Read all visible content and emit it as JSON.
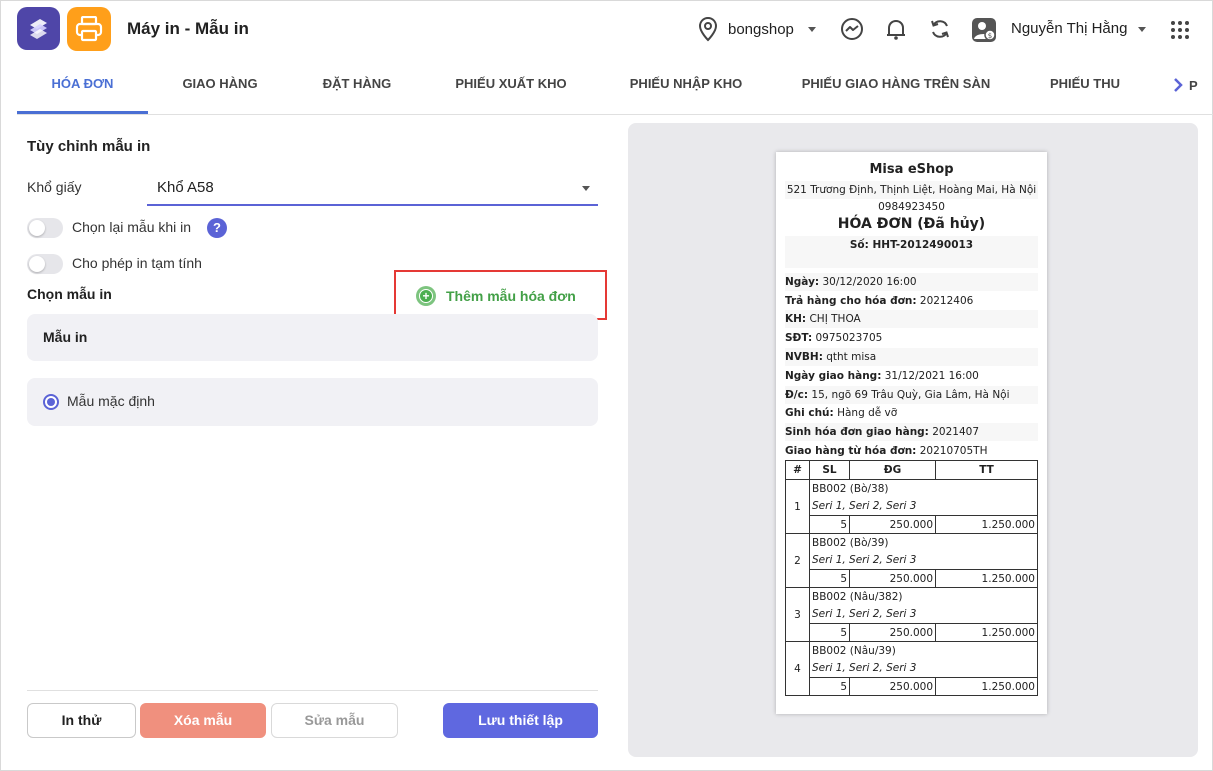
{
  "header": {
    "title": "Máy in - Mẫu in",
    "shop_name": "bongshop",
    "user_name": "Nguyễn Thị Hằng"
  },
  "tabs": [
    {
      "label": "HÓA ĐƠN",
      "active": true
    },
    {
      "label": "GIAO HÀNG"
    },
    {
      "label": "ĐẶT HÀNG"
    },
    {
      "label": "PHIẾU XUẤT KHO"
    },
    {
      "label": "PHIẾU NHẬP KHO"
    },
    {
      "label": "PHIẾU GIAO HÀNG TRÊN SÀN"
    },
    {
      "label": "PHIẾU THU"
    },
    {
      "label": "P"
    }
  ],
  "settings": {
    "title": "Tùy chỉnh mẫu in",
    "paper_label": "Khổ giấy",
    "paper_value": "Khổ A58",
    "toggle_reselect": "Chọn lại mẫu khi in",
    "toggle_temp": "Cho phép in tạm tính",
    "help": "?"
  },
  "templates": {
    "title": "Chọn mẫu in",
    "add_label": "Thêm mẫu hóa đơn",
    "header": "Mẫu in",
    "items": [
      "Mẫu mặc định"
    ]
  },
  "buttons": {
    "test": "In thử",
    "delete": "Xóa mẫu",
    "edit": "Sửa mẫu",
    "save": "Lưu thiết lập"
  },
  "receipt": {
    "shop": "Misa eShop",
    "address": "521 Trương Định, Thịnh Liệt, Hoàng Mai, Hà Nội",
    "phone": "0984923450",
    "title": "HÓA ĐƠN (Đã hủy)",
    "number": "Số: HHT-2012490013",
    "fields": [
      {
        "label": "Ngày:",
        "value": "30/12/2020 16:00"
      },
      {
        "label": "Trả hàng cho hóa đơn:",
        "value": "20212406"
      },
      {
        "label": "KH:",
        "value": "CHỊ THOA"
      },
      {
        "label": "SĐT:",
        "value": "0975023705"
      },
      {
        "label": "NVBH:",
        "value": "qtht misa"
      },
      {
        "label": "Ngày giao hàng:",
        "value": "31/12/2021 16:00"
      },
      {
        "label": "Đ/c:",
        "value": "15, ngõ 69 Trâu Quỳ, Gia Lâm, Hà Nội"
      },
      {
        "label": "Ghi chú:",
        "value": "Hàng dễ vỡ"
      },
      {
        "label": "Sinh hóa đơn giao hàng:",
        "value": "2021407"
      },
      {
        "label": "Giao hàng từ hóa đơn:",
        "value": "20210705TH"
      }
    ],
    "table_headers": [
      "#",
      "SL",
      "ĐG",
      "TT"
    ],
    "items": [
      {
        "idx": "1",
        "name": "BB002 (Bò/38)",
        "serial": "Seri 1, Seri 2, Seri 3",
        "qty": "5",
        "price": "250.000",
        "total": "1.250.000"
      },
      {
        "idx": "2",
        "name": "BB002 (Bò/39)",
        "serial": "Seri 1, Seri 2, Seri 3",
        "qty": "5",
        "price": "250.000",
        "total": "1.250.000"
      },
      {
        "idx": "3",
        "name": "BB002 (Nâu/382)",
        "serial": "Seri 1, Seri 2, Seri 3",
        "qty": "5",
        "price": "250.000",
        "total": "1.250.000"
      },
      {
        "idx": "4",
        "name": "BB002 (Nâu/39)",
        "serial": "Seri 1, Seri 2, Seri 3",
        "qty": "5",
        "price": "250.000",
        "total": "1.250.000"
      }
    ]
  },
  "colors": {
    "accent": "#4a6fd4",
    "primary_button": "#5f68e0",
    "danger_button": "#f0907e",
    "add_green": "#43a047",
    "highlight_border": "#e53935"
  }
}
